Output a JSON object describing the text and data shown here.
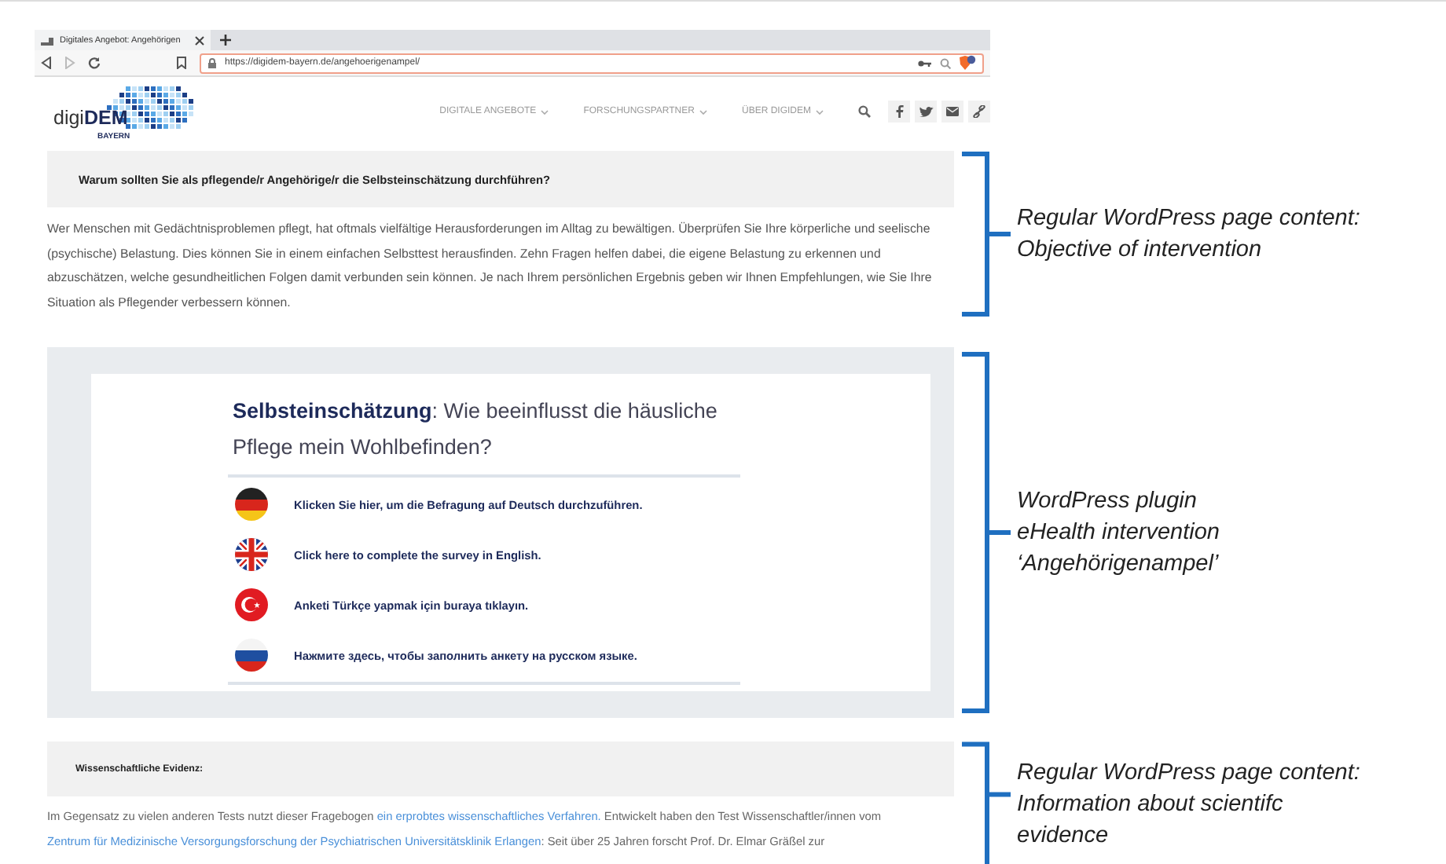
{
  "browser": {
    "tab_title": "Digitales Angebot: Angehörigen",
    "url": "https://digidem-bayern.de/angehoerigenampel/"
  },
  "site_header": {
    "logo": "digi**DEM**",
    "logo_sub": "BAYERN",
    "nav": [
      "DIGITALE ANGEBOTE",
      "FORSCHUNGSPARTNER",
      "ÜBER DIGIDEM"
    ]
  },
  "objective": {
    "heading": "Warum sollten Sie als pflegende/r Angehörige/r die Selbsteinschätzung durchführen?",
    "paragraph": "Wer Menschen mit Gedächtnisproblemen pflegt, hat oftmals vielfältige Herausforderungen im Alltag zu bewältigen. Überprüfen Sie Ihre körperliche und seelische (psychische) Belastung. Dies können Sie in einem einfachen Selbsttest herausfinden. Zehn Fragen helfen dabei, die eigene Belastung zu erkennen und abzuschätzen, welche gesundheitlichen Folgen damit verbunden sein können. Je nach Ihrem persönlichen Ergebnis geben wir Ihnen Empfehlungen, wie Sie Ihre Situation als Pflegender verbessern können.",
    "annotation": [
      "Regular WordPress page content:",
      "Objective of intervention"
    ]
  },
  "plugin": {
    "title": "**Selbsteinschätzung**: Wie beeinflusst die häusliche Pflege mein Wohlbefinden?",
    "languages": [
      {
        "kind": "german",
        "label": "Klicken Sie hier, um die Befragung auf Deutsch durchzuführen."
      },
      {
        "kind": "english",
        "label": "Click here to complete the survey in English."
      },
      {
        "kind": "turkish",
        "label": "Anketi Türkçe yapmak için buraya tıklayın."
      },
      {
        "kind": "russian",
        "label": "Нажмите здесь, чтобы заполнить анкету на русском языке."
      }
    ],
    "annotation": [
      "WordPress plugin",
      "eHealth intervention",
      "‘Angehörigenampel’"
    ]
  },
  "evidence": {
    "heading": "Wissenschaftliche Evidenz:",
    "paragraph": [
      {
        "text": "Im Gegensatz zu vielen anderen Tests nutzt dieser Fragebogen ",
        "link": false
      },
      {
        "text": "ein erprobtes wissenschaftliches Verfahren.",
        "link": true
      },
      {
        "text": " Entwickelt haben den Test Wissenschaftler/innen vom ",
        "link": false
      },
      {
        "text": "Zentrum für Medizinische Versorgungsforschung der Psychiatrischen Universitätsklinik Erlangen",
        "link": true
      },
      {
        "text": ": Seit über 25 Jahren forscht Prof. Dr. Elmar Gräßel zur",
        "link": false
      }
    ],
    "annotation": [
      "Regular WordPress page content:",
      "Information about scientifc",
      "evidence"
    ]
  }
}
